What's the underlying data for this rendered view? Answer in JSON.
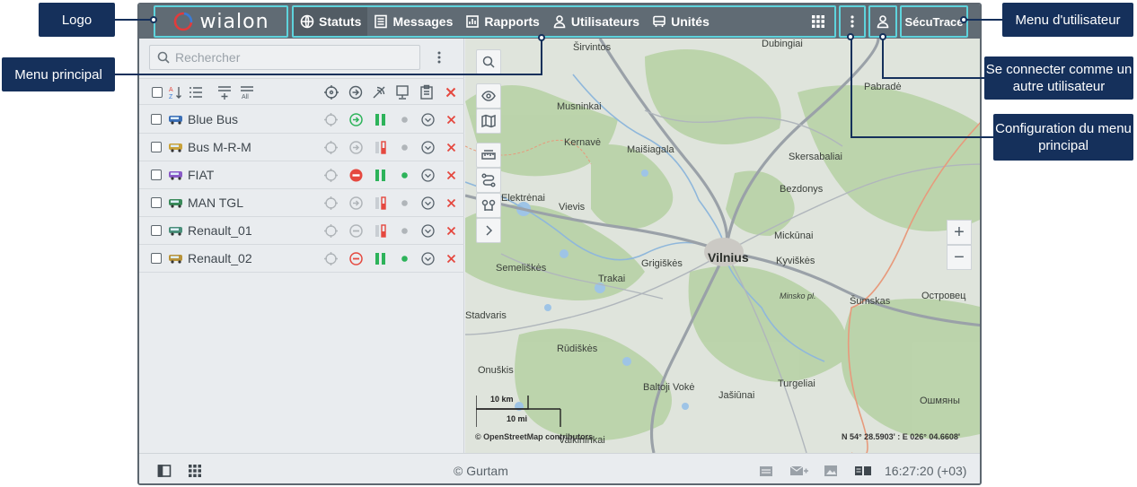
{
  "brand": {
    "logo_text": "wialon"
  },
  "nav": {
    "items": [
      {
        "label": "Statuts",
        "icon": "globe-icon"
      },
      {
        "label": "Messages",
        "icon": "document-icon"
      },
      {
        "label": "Rapports",
        "icon": "report-icon"
      },
      {
        "label": "Utilisateurs",
        "icon": "user-icon"
      },
      {
        "label": "Unités",
        "icon": "vehicle-icon"
      }
    ]
  },
  "user": {
    "name": "SécuTrace"
  },
  "panel": {
    "search_placeholder": "Rechercher",
    "units": [
      {
        "name": "Blue Bus",
        "icon_color": "#3b6fb6",
        "status_color": "#2db35a",
        "motion": "moving",
        "bar": "green",
        "dot": "#b0b5b9"
      },
      {
        "name": "Bus M-R-M",
        "icon_color": "#c9a23a",
        "status_color": "#b0b5b9",
        "motion": "moving",
        "bar": "red",
        "dot": "#b0b5b9"
      },
      {
        "name": "FIAT",
        "icon_color": "#8a5bc7",
        "status_color": "#e5483f",
        "motion": "stopped",
        "bar": "green",
        "dot": "#2db35a"
      },
      {
        "name": "MAN TGL",
        "icon_color": "#3a8a5a",
        "status_color": "#b0b5b9",
        "motion": "moving",
        "bar": "red",
        "dot": "#b0b5b9"
      },
      {
        "name": "Renault_01",
        "icon_color": "#4a8f7a",
        "status_color": "#b0b5b9",
        "motion": "idle",
        "bar": "red",
        "dot": "#b0b5b9"
      },
      {
        "name": "Renault_02",
        "icon_color": "#b8933a",
        "status_color": "#e5483f",
        "motion": "idle",
        "bar": "green",
        "dot": "#2db35a"
      }
    ]
  },
  "map": {
    "places": [
      {
        "label": "Širvintos"
      },
      {
        "label": "Dubingiai"
      },
      {
        "label": "Pabradė"
      },
      {
        "label": "Musninkai"
      },
      {
        "label": "Kernavė"
      },
      {
        "label": "Maišiagala"
      },
      {
        "label": "Skersabaliai"
      },
      {
        "label": "Bezdonys"
      },
      {
        "label": "Elektrėnai"
      },
      {
        "label": "Vievis"
      },
      {
        "label": "Mickūnai"
      },
      {
        "label": "Vilnius"
      },
      {
        "label": "Kyviškės"
      },
      {
        "label": "Semeliškės"
      },
      {
        "label": "Grigiškės"
      },
      {
        "label": "Trakai"
      },
      {
        "label": "Šumskas"
      },
      {
        "label": "Островец"
      },
      {
        "label": "Minsko pl."
      },
      {
        "label": "Stadvaris"
      },
      {
        "label": "Rūdiškės"
      },
      {
        "label": "Onuškis"
      },
      {
        "label": "Baltoji Vokė"
      },
      {
        "label": "Jašiūnai"
      },
      {
        "label": "Turgeliai"
      },
      {
        "label": "Ошмяны"
      },
      {
        "label": "Valkininkai"
      }
    ],
    "scale_km": "10 km",
    "scale_mi": "10 mi",
    "attribution": "© OpenStreetMap contributors",
    "coords": "N 54° 28.5903' : E 026° 04.6608'"
  },
  "statusbar": {
    "copyright": "© Gurtam",
    "clock": "16:27:20 (+03)"
  },
  "callouts": {
    "logo": "Logo",
    "main_menu": "Menu principal",
    "user_menu": "Menu d'utilisateur",
    "login_as": "Se connecter comme un autre utilisateur",
    "menu_config": "Configuration du menu principal"
  },
  "colors": {
    "topbar": "#606b74",
    "highlight": "#5ed3dc",
    "callout": "#15305b"
  }
}
